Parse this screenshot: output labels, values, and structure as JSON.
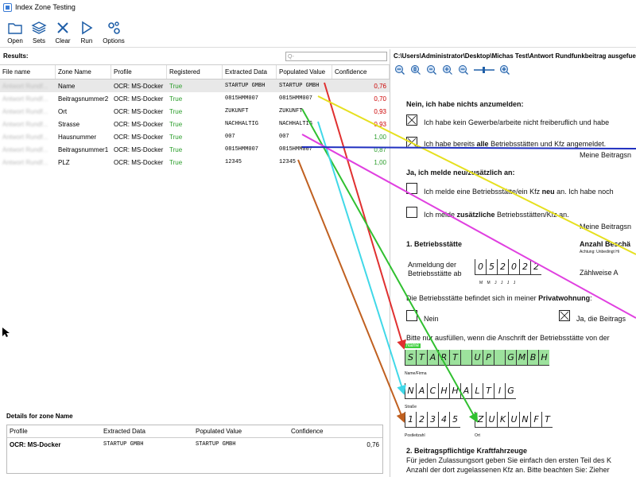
{
  "window": {
    "title": "Index Zone Testing"
  },
  "toolbar": {
    "open": "Open",
    "sets": "Sets",
    "clear": "Clear",
    "run": "Run",
    "options": "Options"
  },
  "results": {
    "label": "Results:",
    "search_placeholder": "Q-",
    "columns": [
      "File name",
      "Zone Name",
      "Profile",
      "Registered",
      "Extracted Data",
      "Populated Value",
      "Confidence"
    ],
    "rows": [
      {
        "file": "Antwort Rundf...",
        "zone": "Name",
        "profile": "OCR: MS-Docker",
        "registered": "True",
        "extracted": "STARTUP GMBH",
        "populated": "STARTUP GMBH",
        "confidence": "0,76"
      },
      {
        "file": "Antwort Rundf...",
        "zone": "Beitragsnummer2",
        "profile": "OCR: MS-Docker",
        "registered": "True",
        "extracted": "0815HMM007",
        "populated": "0815HMM007",
        "confidence": "0,70"
      },
      {
        "file": "Antwort Rundf...",
        "zone": "Ort",
        "profile": "OCR: MS-Docker",
        "registered": "True",
        "extracted": "ZUKUNFT",
        "populated": "ZUKUNFT",
        "confidence": "0,93"
      },
      {
        "file": "Antwort Rundf...",
        "zone": "Strasse",
        "profile": "OCR: MS-Docker",
        "registered": "True",
        "extracted": "NACHHALTIG",
        "populated": "NACHHALTIG",
        "confidence": "0,93"
      },
      {
        "file": "Antwort Rundf...",
        "zone": "Hausnummer",
        "profile": "OCR: MS-Docker",
        "registered": "True",
        "extracted": "007",
        "populated": "007",
        "confidence": "1,00"
      },
      {
        "file": "Antwort Rundf...",
        "zone": "Beitragsnummer1",
        "profile": "OCR: MS-Docker",
        "registered": "True",
        "extracted": "0815HMM007",
        "populated": "0815HMM007",
        "confidence": "0,87"
      },
      {
        "file": "Antwort Rundf...",
        "zone": "PLZ",
        "profile": "OCR: MS-Docker",
        "registered": "True",
        "extracted": "12345",
        "populated": "12345",
        "confidence": "1,00"
      }
    ]
  },
  "details": {
    "label": "Details for zone Name",
    "columns": [
      "Profile",
      "Extracted Data",
      "Populated Value",
      "Confidence"
    ],
    "row": {
      "profile": "OCR: MS-Docker",
      "extracted": "STARTUP GMBH",
      "populated": "STARTUP GMBH",
      "confidence": "0,76"
    }
  },
  "viewer": {
    "path": "C:\\Users\\Administrator\\Desktop\\Michas Test\\Antwort Rundfunkbeitrag ausgefuell",
    "doc": {
      "h1": "Nein, ich habe nichts anzumelden:",
      "opt1": "Ich habe kein Gewerbe/arbeite nicht freiberuflich und habe",
      "opt2_pre": "Ich habe bereits ",
      "opt2_bold": "alle",
      "opt2_post": " Betriebsstätten und Kfz angemeldet.",
      "beitrag1": "Meine Beitragsn",
      "h2": "Ja, ich melde neu/zusätzlich an:",
      "opt3_pre": "Ich melde eine Betriebsstätte/ein Kfz ",
      "opt3_bold": "neu",
      "opt3_post": " an. Ich habe noch",
      "opt4_pre": "Ich melde ",
      "opt4_bold": "zusätzliche",
      "opt4_post": " Betriebsstätten/Kfz an.",
      "beitrag2": "Meine Beitragsn",
      "sec1": "1. Betriebsstätte",
      "anzahl": "Anzahl Beschä",
      "achtung": "Achtung: Unbedingt Hi",
      "anmeldung": "Anmeldung der",
      "anmeldung2": "Betriebsstätte ab",
      "date_digits": [
        "0",
        "5",
        "2",
        "0",
        "2",
        "2"
      ],
      "date_fmt": "M  M  J  J  J  J",
      "zaehl": "Zählweise A",
      "privat_pre": "Die Betriebsstätte befindet sich in meiner ",
      "privat_bold": "Privatwohnung",
      "privat_post": ":",
      "nein": "Nein",
      "ja": "Ja, die Beitrags",
      "bitte": "Bitte nur ausfüllen, wenn die Anschrift der Betriebsstätte von der",
      "name_tag": "Name",
      "name_letters": [
        "S",
        "T",
        "A",
        "R",
        "T",
        "",
        "U",
        "P",
        "",
        "G",
        "M",
        "B",
        "H"
      ],
      "name_lbl": "Name/Firma",
      "street_letters": [
        "N",
        "A",
        "C",
        "H",
        "H",
        "A",
        "L",
        "T",
        "I",
        "G"
      ],
      "street_lbl": "Straße",
      "plz_letters": [
        "1",
        "2",
        "3",
        "4",
        "5"
      ],
      "plz_lbl": "Postleitzahl",
      "ort_letters": [
        "Z",
        "U",
        "K",
        "U",
        "N",
        "F",
        "T"
      ],
      "ort_lbl": "Ort",
      "sec2": "2. Beitragspflichtige Kraftfahrzeuge",
      "p1": "Für jeden Zulassungsort geben Sie einfach den ersten Teil des K",
      "p2": "Anzahl der dort zugelassenen Kfz an. Bitte beachten Sie: Zieher"
    }
  },
  "colors": {
    "true": "#2a9d2a",
    "conf_low": "#cc0000",
    "highlight": "#9de29d"
  }
}
